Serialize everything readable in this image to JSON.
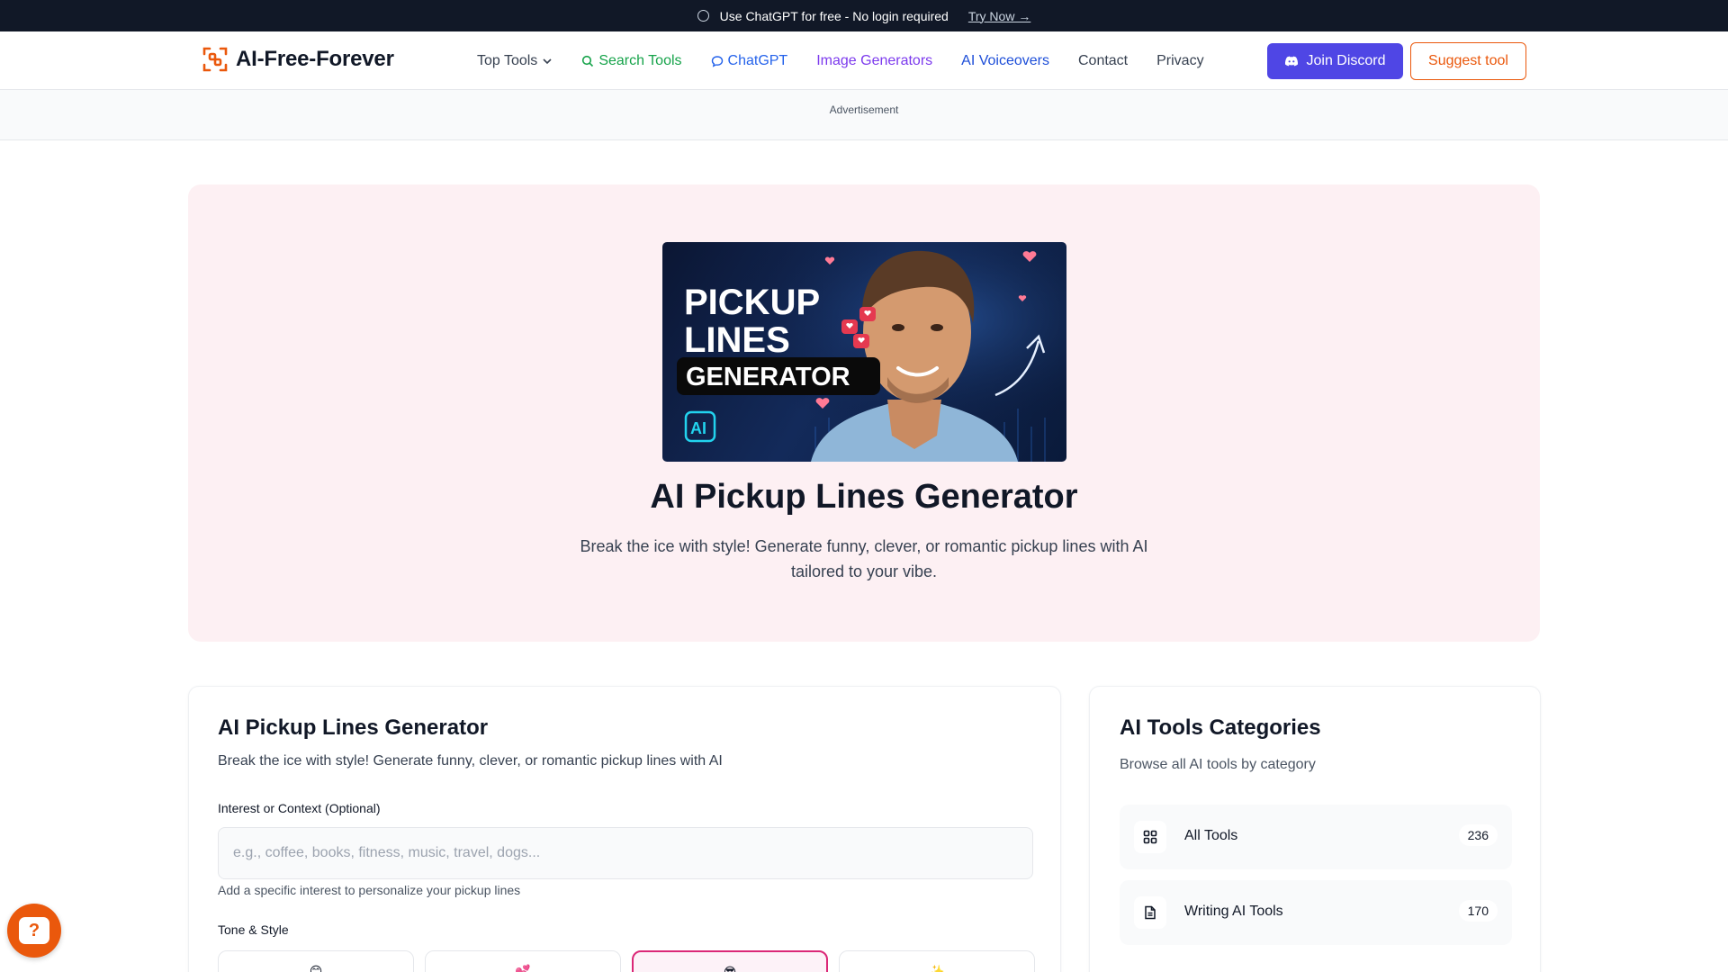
{
  "promo": {
    "text": "Use ChatGPT for free - No login required",
    "cta": "Try Now →"
  },
  "header": {
    "logo": "AI-Free-Forever",
    "nav": {
      "top_tools": "Top Tools",
      "search_tools": "Search Tools",
      "chatgpt": "ChatGPT",
      "image_generators": "Image Generators",
      "ai_voiceovers": "AI Voiceovers",
      "contact": "Contact",
      "privacy": "Privacy"
    },
    "join_discord": "Join Discord",
    "suggest_tool": "Suggest tool"
  },
  "ad": {
    "label": "Advertisement"
  },
  "hero": {
    "image_text": {
      "line1": "PICKUP",
      "line2": "LINES",
      "line3": "GENERATOR",
      "badge": "AI"
    },
    "title": "AI Pickup Lines Generator",
    "subtitle": "Break the ice with style! Generate funny, clever, or romantic pickup lines with AI tailored to your vibe."
  },
  "form": {
    "title": "AI Pickup Lines Generator",
    "description": "Break the ice with style! Generate funny, clever, or romantic pickup lines with AI",
    "interest_label": "Interest or Context (Optional)",
    "interest_placeholder": "e.g., coffee, books, fitness, music, travel, dogs...",
    "interest_value": "",
    "interest_help": "Add a specific interest to personalize your pickup lines",
    "tone_label": "Tone & Style",
    "tones": [
      {
        "icon": "😊"
      },
      {
        "icon": "💕"
      },
      {
        "icon": "😎"
      },
      {
        "icon": "✨"
      }
    ]
  },
  "sidebar": {
    "title": "AI Tools Categories",
    "description": "Browse all AI tools by category",
    "categories": [
      {
        "name": "All Tools",
        "count": "236",
        "icon": "grid-icon"
      },
      {
        "name": "Writing AI Tools",
        "count": "170",
        "icon": "document-icon"
      }
    ]
  },
  "colors": {
    "promo_bg": "#111827",
    "discord": "#4f46e5",
    "accent_orange": "#ea580c",
    "hero_bg": "#fdf0f3",
    "tone_active": "#db2777"
  }
}
